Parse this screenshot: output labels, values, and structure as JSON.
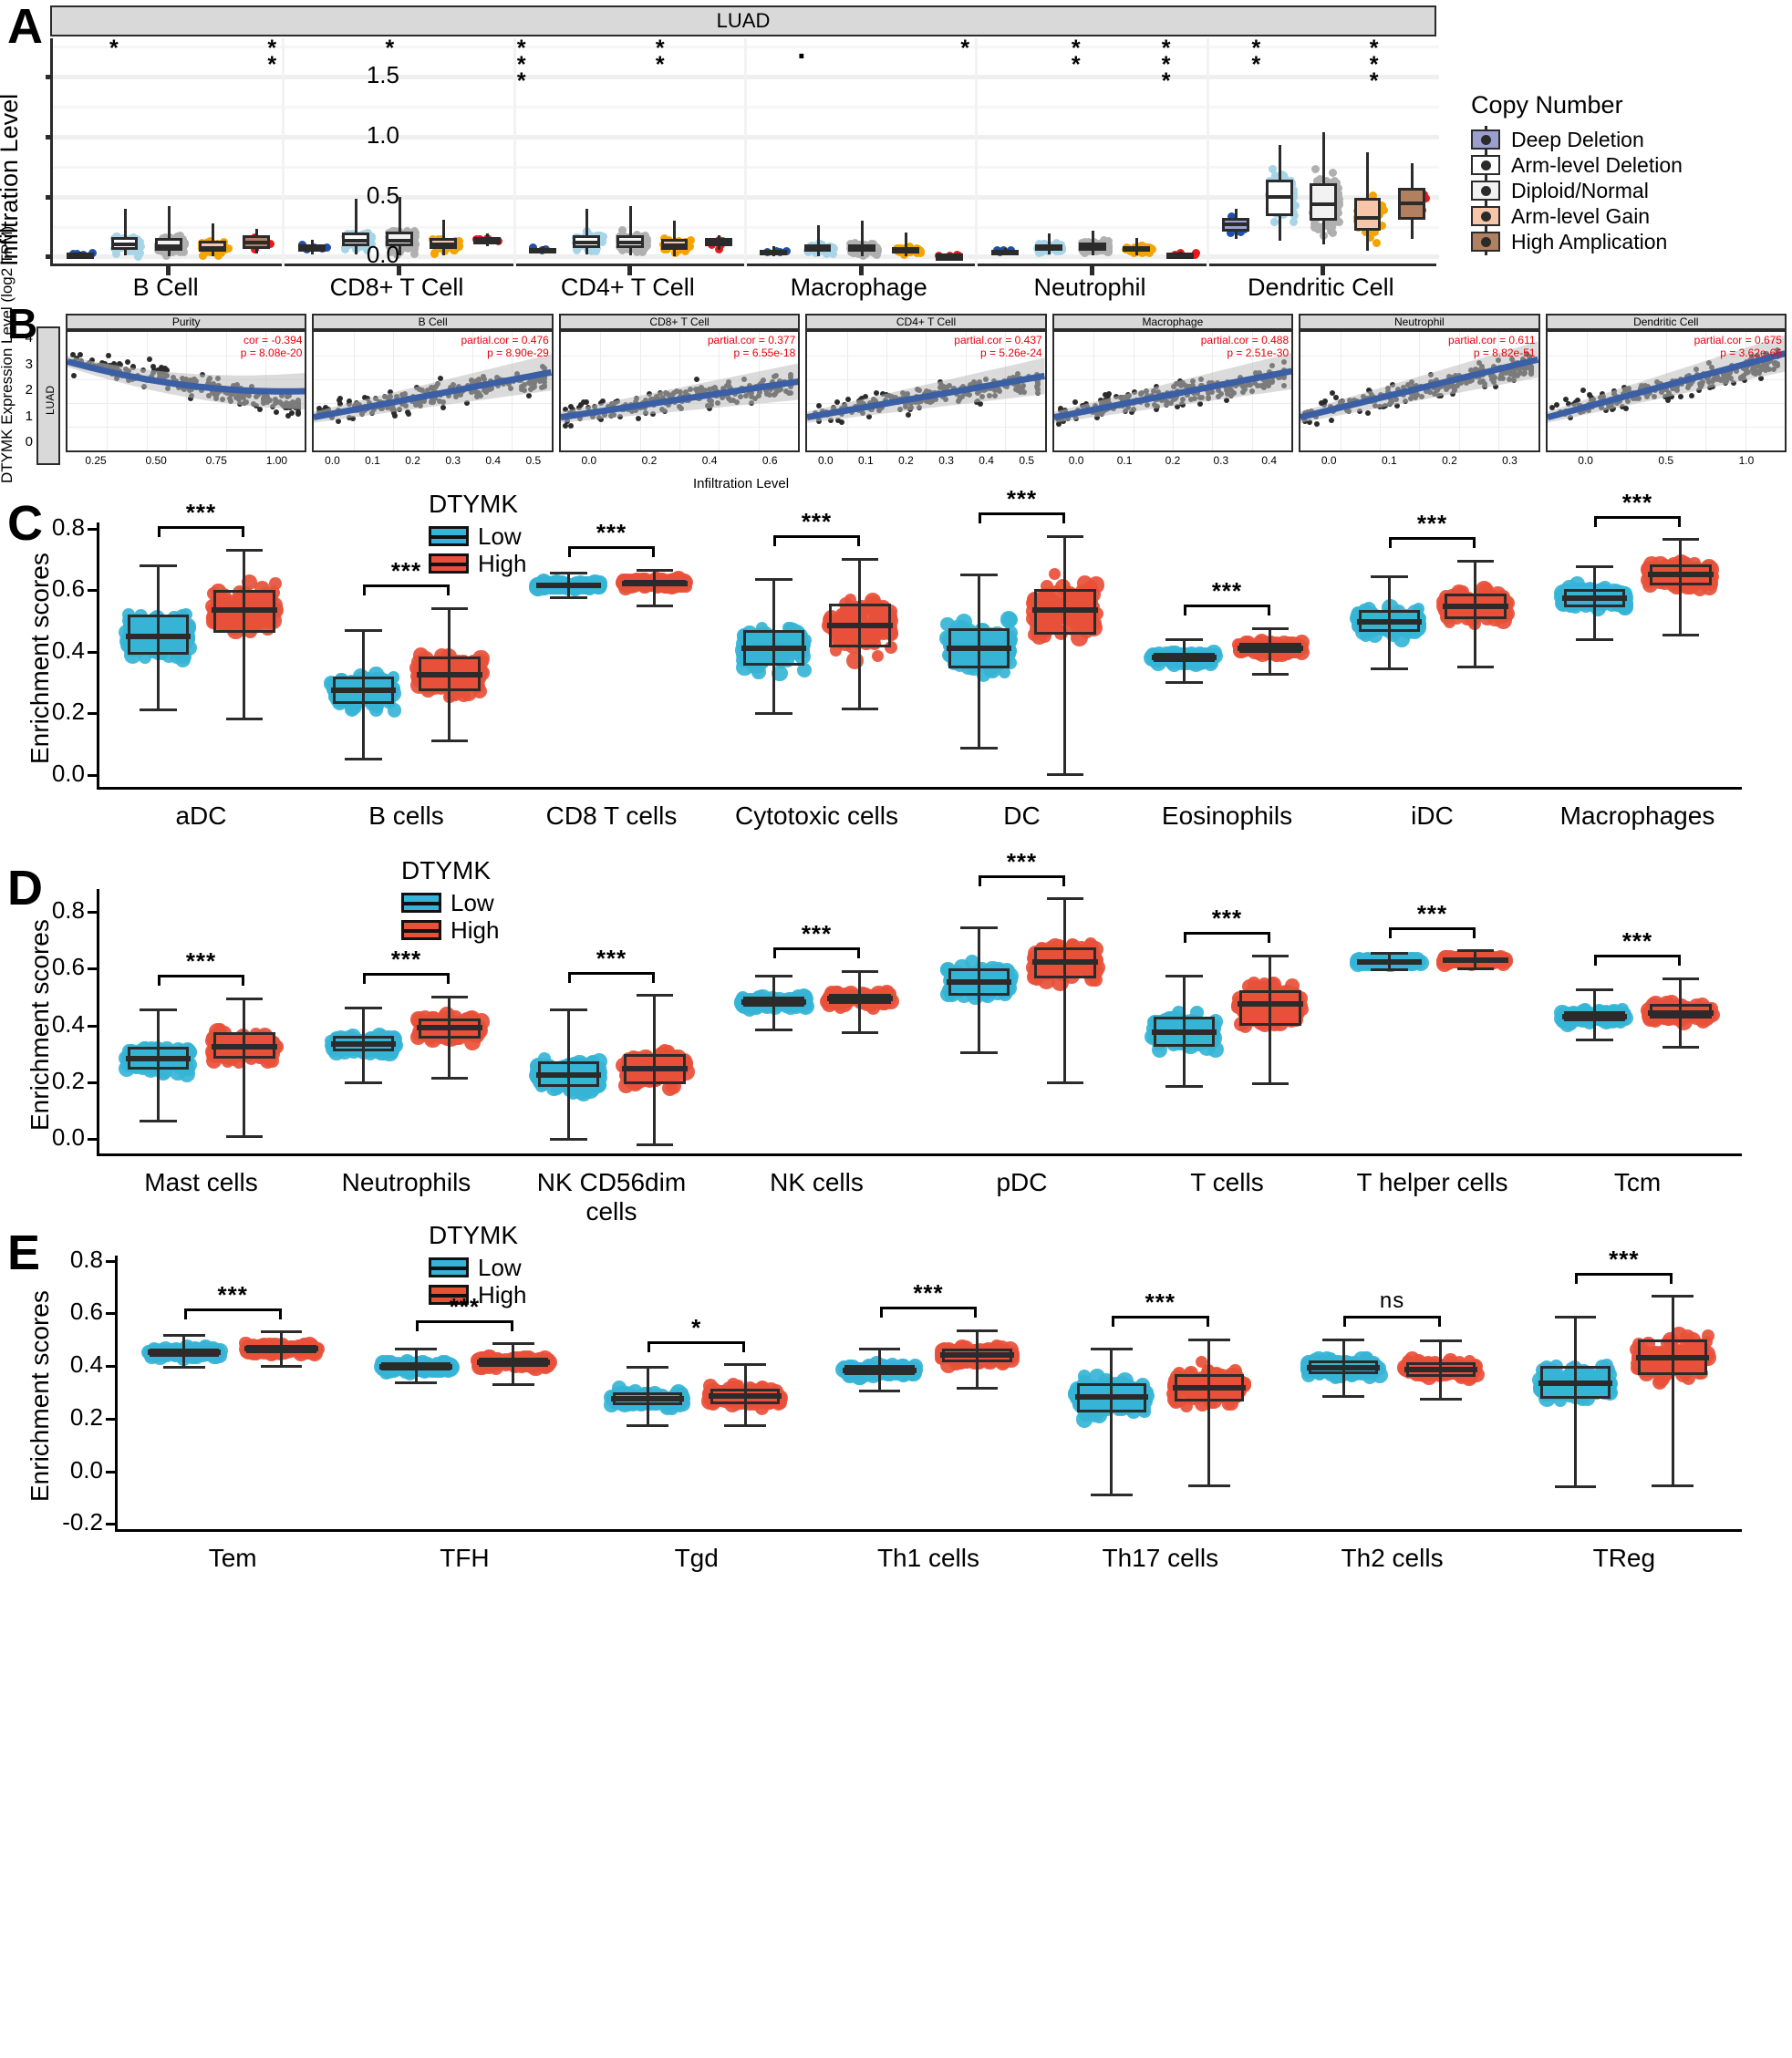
{
  "figure": {
    "panel_letters": [
      "A",
      "B",
      "C",
      "D",
      "E"
    ]
  },
  "panelA": {
    "letter": "A",
    "strip_title": "LUAD",
    "y_axis_label": "Infiltration Level",
    "y_ticks": [
      "0.0",
      "0.5",
      "1.0",
      "1.5"
    ],
    "y_tick_values": [
      0.0,
      0.5,
      1.0,
      1.5
    ],
    "y_range": [
      -0.08,
      1.82
    ],
    "x_categories": [
      "B Cell",
      "CD8+ T Cell",
      "CD4+ T Cell",
      "Macrophage",
      "Neutrophil",
      "Dendritic Cell"
    ],
    "legend": {
      "title": "Copy Number",
      "items": [
        {
          "label": "Deep Deletion",
          "color": "#9b9fd0"
        },
        {
          "label": "Arm-level Deletion",
          "color": "#ffffff"
        },
        {
          "label": "Diploid/Normal",
          "color": "#f2f2f2"
        },
        {
          "label": "Arm-level Gain",
          "color": "#f7c6a8"
        },
        {
          "label": "High Amplication",
          "color": "#b08060"
        }
      ]
    },
    "point_colors": {
      "deep_deletion": "#1f4fa8",
      "arm_level_deletion": "#a8d4e8",
      "diploid_normal": "#b0b0b0",
      "arm_level_gain": "#f5a300",
      "high_amplication": "#e8191b"
    },
    "significance_marks": [
      {
        "x_pct": 4.6,
        "stars": "*"
      },
      {
        "x_pct": 16.0,
        "stars": "*\n*"
      },
      {
        "x_pct": 24.5,
        "stars": "*"
      },
      {
        "x_pct": 34.0,
        "stars": "*\n*\n*"
      },
      {
        "x_pct": 44.0,
        "stars": "*\n*"
      },
      {
        "x_pct": 54.2,
        "stars": "."
      },
      {
        "x_pct": 66.0,
        "stars": "*"
      },
      {
        "x_pct": 74.0,
        "stars": "*\n*"
      },
      {
        "x_pct": 80.5,
        "stars": "*\n*\n*"
      },
      {
        "x_pct": 87.0,
        "stars": "*\n*"
      },
      {
        "x_pct": 95.5,
        "stars": "*\n*\n*"
      }
    ]
  },
  "panelB": {
    "letter": "B",
    "y_axis_label": "DTYMK Expression Level (log2 TPM)",
    "x_axis_label": "Infiltration Level",
    "row_strip": "LUAD",
    "y_ticks": [
      "0",
      "1",
      "2",
      "3",
      "4"
    ],
    "subpanels": [
      {
        "title": "Purity",
        "cor_label": "cor = -0.394",
        "p_label": "p = 8.08e-20",
        "x_ticks": [
          "0.25",
          "0.50",
          "0.75",
          "1.00"
        ]
      },
      {
        "title": "B Cell",
        "cor_label": "partial.cor = 0.476",
        "p_label": "p = 8.90e-29",
        "x_ticks": [
          "0.0",
          "0.1",
          "0.2",
          "0.3",
          "0.4",
          "0.5"
        ]
      },
      {
        "title": "CD8+ T Cell",
        "cor_label": "partial.cor = 0.377",
        "p_label": "p = 6.55e-18",
        "x_ticks": [
          "0.0",
          "0.2",
          "0.4",
          "0.6"
        ]
      },
      {
        "title": "CD4+ T Cell",
        "cor_label": "partial.cor = 0.437",
        "p_label": "p = 5.26e-24",
        "x_ticks": [
          "0.0",
          "0.1",
          "0.2",
          "0.3",
          "0.4",
          "0.5"
        ]
      },
      {
        "title": "Macrophage",
        "cor_label": "partial.cor = 0.488",
        "p_label": "p = 2.51e-30",
        "x_ticks": [
          "0.0",
          "0.1",
          "0.2",
          "0.3",
          "0.4"
        ]
      },
      {
        "title": "Neutrophil",
        "cor_label": "partial.cor = 0.611",
        "p_label": "p = 8.82e-51",
        "x_ticks": [
          "0.0",
          "0.1",
          "0.2",
          "0.3"
        ]
      },
      {
        "title": "Dendritic Cell",
        "cor_label": "partial.cor = 0.675",
        "p_label": "p = 3.62e-66",
        "x_ticks": [
          "0.0",
          "0.5",
          "1.0"
        ]
      }
    ],
    "trend_color": "#3b5fa5",
    "point_color": "#2b2b2b"
  },
  "panelC": {
    "letter": "C",
    "y_axis_label": "Enrichment scores",
    "y_ticks": [
      "0.0",
      "0.2",
      "0.4",
      "0.6",
      "0.8"
    ],
    "y_tick_values": [
      0.0,
      0.2,
      0.4,
      0.6,
      0.8
    ],
    "y_range": [
      -0.04,
      0.82
    ],
    "legend": {
      "title": "DTYMK",
      "items": [
        {
          "label": "Low",
          "color": "#35b4d6"
        },
        {
          "label": "High",
          "color": "#e8503a"
        }
      ]
    },
    "groups": [
      {
        "name": "aDC",
        "sig": "***",
        "low": {
          "min": 0.21,
          "q1": 0.39,
          "median": 0.45,
          "q3": 0.52,
          "max": 0.68
        },
        "high": {
          "min": 0.18,
          "q1": 0.46,
          "median": 0.535,
          "q3": 0.6,
          "max": 0.73
        }
      },
      {
        "name": "B cells",
        "sig": "***",
        "low": {
          "min": 0.05,
          "q1": 0.23,
          "median": 0.275,
          "q3": 0.32,
          "max": 0.47
        },
        "high": {
          "min": 0.11,
          "q1": 0.27,
          "median": 0.325,
          "q3": 0.385,
          "max": 0.54
        }
      },
      {
        "name": "CD8 T cells",
        "sig": "***",
        "low": {
          "min": 0.575,
          "q1": 0.605,
          "median": 0.615,
          "q3": 0.625,
          "max": 0.655
        },
        "high": {
          "min": 0.55,
          "q1": 0.612,
          "median": 0.622,
          "q3": 0.633,
          "max": 0.665
        }
      },
      {
        "name": "Cytotoxic cells",
        "sig": "***",
        "low": {
          "min": 0.2,
          "q1": 0.355,
          "median": 0.41,
          "q3": 0.47,
          "max": 0.635
        },
        "high": {
          "min": 0.215,
          "q1": 0.415,
          "median": 0.485,
          "q3": 0.555,
          "max": 0.7
        }
      },
      {
        "name": "DC",
        "sig": "***",
        "low": {
          "min": 0.085,
          "q1": 0.345,
          "median": 0.41,
          "q3": 0.475,
          "max": 0.65
        },
        "high": {
          "min": 0.0,
          "q1": 0.455,
          "median": 0.535,
          "q3": 0.605,
          "max": 0.775
        }
      },
      {
        "name": "Eosinophils",
        "sig": "***",
        "low": {
          "min": 0.3,
          "q1": 0.365,
          "median": 0.38,
          "q3": 0.395,
          "max": 0.44
        },
        "high": {
          "min": 0.325,
          "q1": 0.395,
          "median": 0.412,
          "q3": 0.428,
          "max": 0.475
        }
      },
      {
        "name": "iDC",
        "sig": "***",
        "low": {
          "min": 0.345,
          "q1": 0.465,
          "median": 0.497,
          "q3": 0.535,
          "max": 0.645
        },
        "high": {
          "min": 0.35,
          "q1": 0.505,
          "median": 0.548,
          "q3": 0.59,
          "max": 0.695
        }
      },
      {
        "name": "Macrophages",
        "sig": "***",
        "low": {
          "min": 0.44,
          "q1": 0.545,
          "median": 0.575,
          "q3": 0.605,
          "max": 0.675
        },
        "high": {
          "min": 0.455,
          "q1": 0.615,
          "median": 0.652,
          "q3": 0.685,
          "max": 0.765
        }
      }
    ]
  },
  "panelD": {
    "letter": "D",
    "y_axis_label": "Enrichment scores",
    "y_ticks": [
      "0.0",
      "0.2",
      "0.4",
      "0.6",
      "0.8"
    ],
    "y_tick_values": [
      0.0,
      0.2,
      0.4,
      0.6,
      0.8
    ],
    "y_range": [
      -0.05,
      0.88
    ],
    "legend": {
      "title": "DTYMK",
      "items": [
        {
          "label": "Low",
          "color": "#35b4d6"
        },
        {
          "label": "High",
          "color": "#e8503a"
        }
      ]
    },
    "groups": [
      {
        "name": "Mast cells",
        "sig": "***",
        "low": {
          "min": 0.065,
          "q1": 0.245,
          "median": 0.285,
          "q3": 0.325,
          "max": 0.455
        },
        "high": {
          "min": 0.01,
          "q1": 0.285,
          "median": 0.325,
          "q3": 0.375,
          "max": 0.495
        }
      },
      {
        "name": "Neutrophils",
        "sig": "***",
        "low": {
          "min": 0.2,
          "q1": 0.31,
          "median": 0.335,
          "q3": 0.365,
          "max": 0.46
        },
        "high": {
          "min": 0.215,
          "q1": 0.355,
          "median": 0.392,
          "q3": 0.425,
          "max": 0.5
        }
      },
      {
        "name": "NK CD56dim cells",
        "sig": "***",
        "low": {
          "min": 0.0,
          "q1": 0.185,
          "median": 0.225,
          "q3": 0.275,
          "max": 0.455
        },
        "high": {
          "min": -0.02,
          "q1": 0.195,
          "median": 0.248,
          "q3": 0.3,
          "max": 0.505
        }
      },
      {
        "name": "NK cells",
        "sig": "***",
        "low": {
          "min": 0.385,
          "q1": 0.465,
          "median": 0.482,
          "q3": 0.5,
          "max": 0.575
        },
        "high": {
          "min": 0.375,
          "q1": 0.475,
          "median": 0.495,
          "q3": 0.512,
          "max": 0.59
        }
      },
      {
        "name": "pDC",
        "sig": "***",
        "low": {
          "min": 0.305,
          "q1": 0.505,
          "median": 0.553,
          "q3": 0.6,
          "max": 0.745
        },
        "high": {
          "min": 0.2,
          "q1": 0.565,
          "median": 0.625,
          "q3": 0.675,
          "max": 0.845
        }
      },
      {
        "name": "T cells",
        "sig": "***",
        "low": {
          "min": 0.185,
          "q1": 0.325,
          "median": 0.378,
          "q3": 0.43,
          "max": 0.575
        },
        "high": {
          "min": 0.195,
          "q1": 0.4,
          "median": 0.475,
          "q3": 0.525,
          "max": 0.645
        }
      },
      {
        "name": "T helper cells",
        "sig": "***",
        "low": {
          "min": 0.595,
          "q1": 0.618,
          "median": 0.625,
          "q3": 0.633,
          "max": 0.655
        },
        "high": {
          "min": 0.6,
          "q1": 0.622,
          "median": 0.63,
          "q3": 0.638,
          "max": 0.662
        }
      },
      {
        "name": "Tcm",
        "sig": "***",
        "low": {
          "min": 0.35,
          "q1": 0.415,
          "median": 0.43,
          "q3": 0.45,
          "max": 0.525
        },
        "high": {
          "min": 0.325,
          "q1": 0.425,
          "median": 0.445,
          "q3": 0.475,
          "max": 0.565
        }
      }
    ]
  },
  "panelE": {
    "letter": "E",
    "y_axis_label": "Enrichment scores",
    "y_ticks": [
      "-0.2",
      "0.0",
      "0.2",
      "0.4",
      "0.6",
      "0.8"
    ],
    "y_tick_values": [
      -0.2,
      0.0,
      0.2,
      0.4,
      0.6,
      0.8
    ],
    "y_range": [
      -0.22,
      0.82
    ],
    "legend": {
      "title": "DTYMK",
      "items": [
        {
          "label": "Low",
          "color": "#35b4d6"
        },
        {
          "label": "High",
          "color": "#e8503a"
        }
      ]
    },
    "groups": [
      {
        "name": "Tem",
        "sig": "***",
        "low": {
          "min": 0.395,
          "q1": 0.435,
          "median": 0.452,
          "q3": 0.468,
          "max": 0.515
        },
        "high": {
          "min": 0.4,
          "q1": 0.448,
          "median": 0.465,
          "q3": 0.482,
          "max": 0.53
        }
      },
      {
        "name": "TFH",
        "sig": "***",
        "low": {
          "min": 0.335,
          "q1": 0.382,
          "median": 0.398,
          "q3": 0.415,
          "max": 0.465
        },
        "high": {
          "min": 0.33,
          "q1": 0.398,
          "median": 0.415,
          "q3": 0.432,
          "max": 0.485
        }
      },
      {
        "name": "Tgd",
        "sig": "*",
        "low": {
          "min": 0.175,
          "q1": 0.25,
          "median": 0.275,
          "q3": 0.3,
          "max": 0.395
        },
        "high": {
          "min": 0.175,
          "q1": 0.255,
          "median": 0.285,
          "q3": 0.315,
          "max": 0.405
        }
      },
      {
        "name": "Th1 cells",
        "sig": "***",
        "low": {
          "min": 0.305,
          "q1": 0.365,
          "median": 0.383,
          "q3": 0.405,
          "max": 0.465
        },
        "high": {
          "min": 0.315,
          "q1": 0.415,
          "median": 0.442,
          "q3": 0.468,
          "max": 0.535
        }
      },
      {
        "name": "Th17 cells",
        "sig": "***",
        "low": {
          "min": -0.09,
          "q1": 0.225,
          "median": 0.282,
          "q3": 0.335,
          "max": 0.465
        },
        "high": {
          "min": -0.055,
          "q1": 0.265,
          "median": 0.318,
          "q3": 0.37,
          "max": 0.5
        }
      },
      {
        "name": "Th2 cells",
        "sig": "ns",
        "low": {
          "min": 0.285,
          "q1": 0.368,
          "median": 0.395,
          "q3": 0.422,
          "max": 0.5
        },
        "high": {
          "min": 0.275,
          "q1": 0.358,
          "median": 0.388,
          "q3": 0.415,
          "max": 0.495
        }
      },
      {
        "name": "TReg",
        "sig": "***",
        "low": {
          "min": -0.06,
          "q1": 0.275,
          "median": 0.335,
          "q3": 0.4,
          "max": 0.585
        },
        "high": {
          "min": -0.055,
          "q1": 0.365,
          "median": 0.432,
          "q3": 0.5,
          "max": 0.665
        }
      }
    ]
  }
}
